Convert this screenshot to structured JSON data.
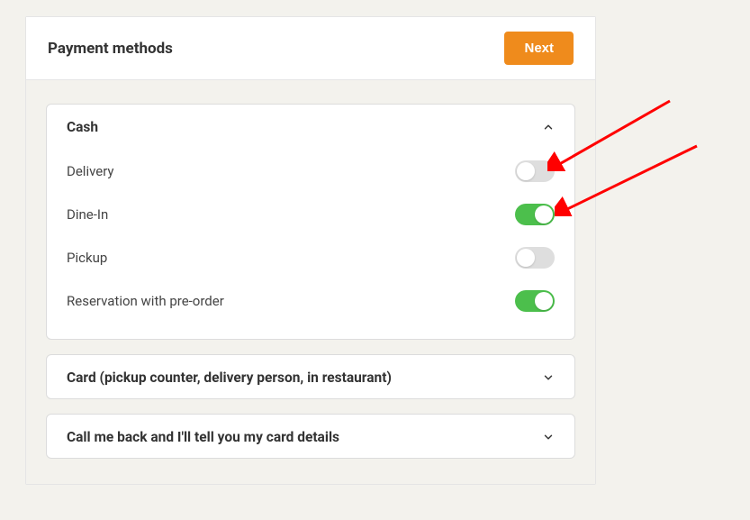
{
  "header": {
    "title": "Payment methods",
    "next_button_label": "Next"
  },
  "accordions": [
    {
      "title": "Cash",
      "expanded": true,
      "rows": [
        {
          "label": "Delivery",
          "enabled": false
        },
        {
          "label": "Dine-In",
          "enabled": true
        },
        {
          "label": "Pickup",
          "enabled": false
        },
        {
          "label": "Reservation with pre-order",
          "enabled": true
        }
      ]
    },
    {
      "title": "Card (pickup counter, delivery person, in restaurant)",
      "expanded": false
    },
    {
      "title": "Call me back and I'll tell you my card details",
      "expanded": false
    }
  ],
  "colors": {
    "accent_orange": "#ef8b1c",
    "toggle_on_green": "#4cbf4c",
    "toggle_off_grey": "#dedede",
    "arrow_red": "#ff0000"
  }
}
